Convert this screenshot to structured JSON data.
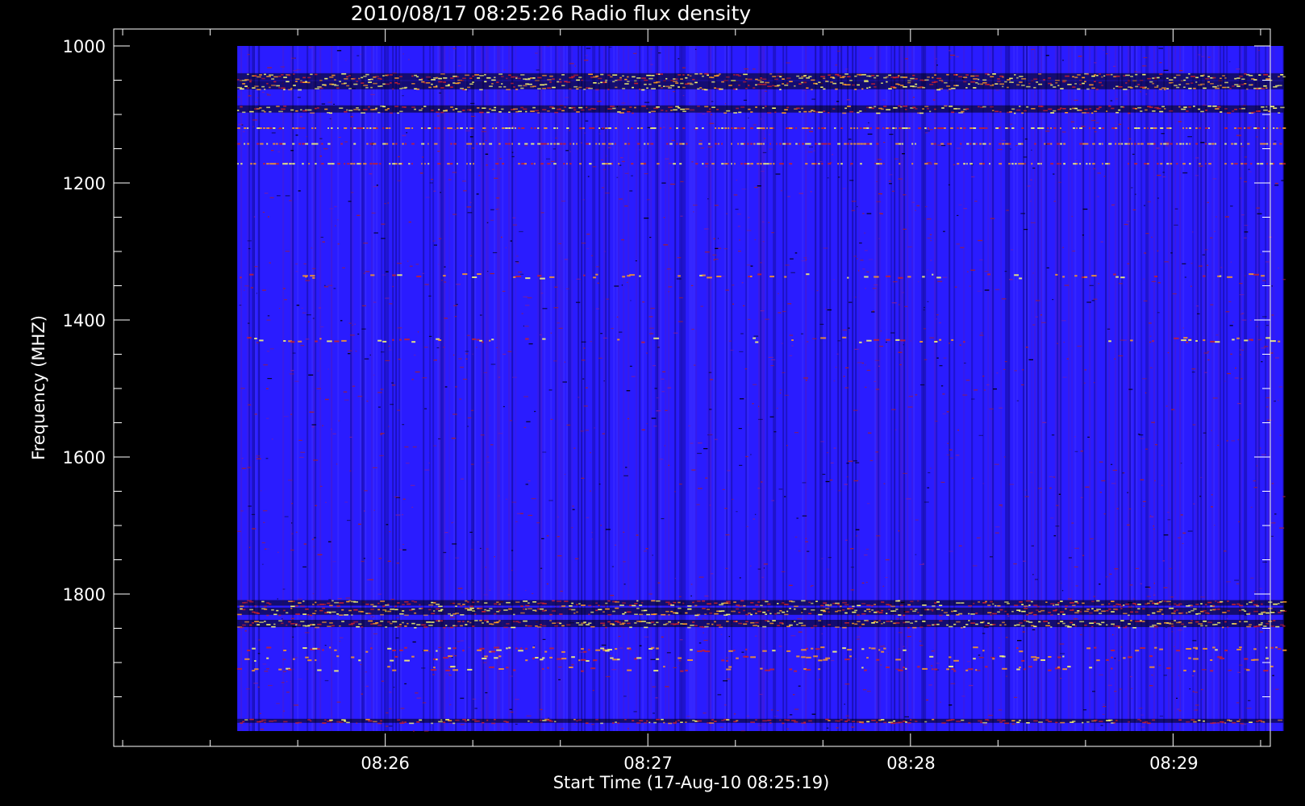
{
  "chart_data": {
    "type": "heatmap",
    "title": "2010/08/17 08:25:26 Radio flux density",
    "xlabel": "Start Time (17-Aug-10 08:25:19)",
    "ylabel": "Frequency (MHZ)",
    "x_axis": {
      "unit": "minutes after 08:25:19",
      "range": [
        -0.35,
        4.05
      ],
      "data_range": [
        0.12,
        4.1
      ],
      "major_ticks": [
        {
          "value": 0.683,
          "label": "08:26"
        },
        {
          "value": 1.683,
          "label": "08:27"
        },
        {
          "value": 2.683,
          "label": "08:28"
        },
        {
          "value": 3.683,
          "label": "08:29"
        }
      ],
      "minor_tick_step_minutes": 0.333
    },
    "y_axis": {
      "unit": "MHz",
      "range": [
        1000,
        2000
      ],
      "inverted": true,
      "major_ticks": [
        1000,
        1200,
        1400,
        1600,
        1800
      ],
      "minor_tick_step": 50
    },
    "colormap": [
      "#000000",
      "#1a10c8",
      "#2a1cff",
      "#c81f2e",
      "#ff9a24",
      "#ffff70"
    ],
    "background_level_color": "#2a1cff",
    "features": [
      {
        "frequency_mhz": 1045,
        "intensity": "high",
        "kind": "continuous interference band"
      },
      {
        "frequency_mhz": 1057,
        "intensity": "very high",
        "kind": "continuous interference band"
      },
      {
        "frequency_mhz": 1092,
        "intensity": "high",
        "kind": "continuous interference band"
      },
      {
        "frequency_mhz": 1120,
        "intensity": "medium",
        "kind": "dotted interference line"
      },
      {
        "frequency_mhz": 1143,
        "intensity": "medium",
        "kind": "dotted interference line"
      },
      {
        "frequency_mhz": 1172,
        "intensity": "low",
        "kind": "dotted interference line"
      },
      {
        "frequency_mhz": 1335,
        "intensity": "low",
        "kind": "intermittent patches"
      },
      {
        "frequency_mhz": 1428,
        "intensity": "low",
        "kind": "intermittent patches"
      },
      {
        "frequency_mhz": 1813,
        "intensity": "medium",
        "kind": "continuous interference band"
      },
      {
        "frequency_mhz": 1825,
        "intensity": "high",
        "kind": "continuous interference band"
      },
      {
        "frequency_mhz": 1843,
        "intensity": "high",
        "kind": "continuous interference band"
      },
      {
        "frequency_mhz": 1880,
        "intensity": "medium",
        "kind": "intermittent patches"
      },
      {
        "frequency_mhz": 1893,
        "intensity": "medium",
        "kind": "intermittent patches"
      },
      {
        "frequency_mhz": 1908,
        "intensity": "medium",
        "kind": "intermittent patches"
      },
      {
        "frequency_mhz": 1985,
        "intensity": "low",
        "kind": "continuous interference band"
      }
    ],
    "grid": false,
    "legend": "none"
  }
}
